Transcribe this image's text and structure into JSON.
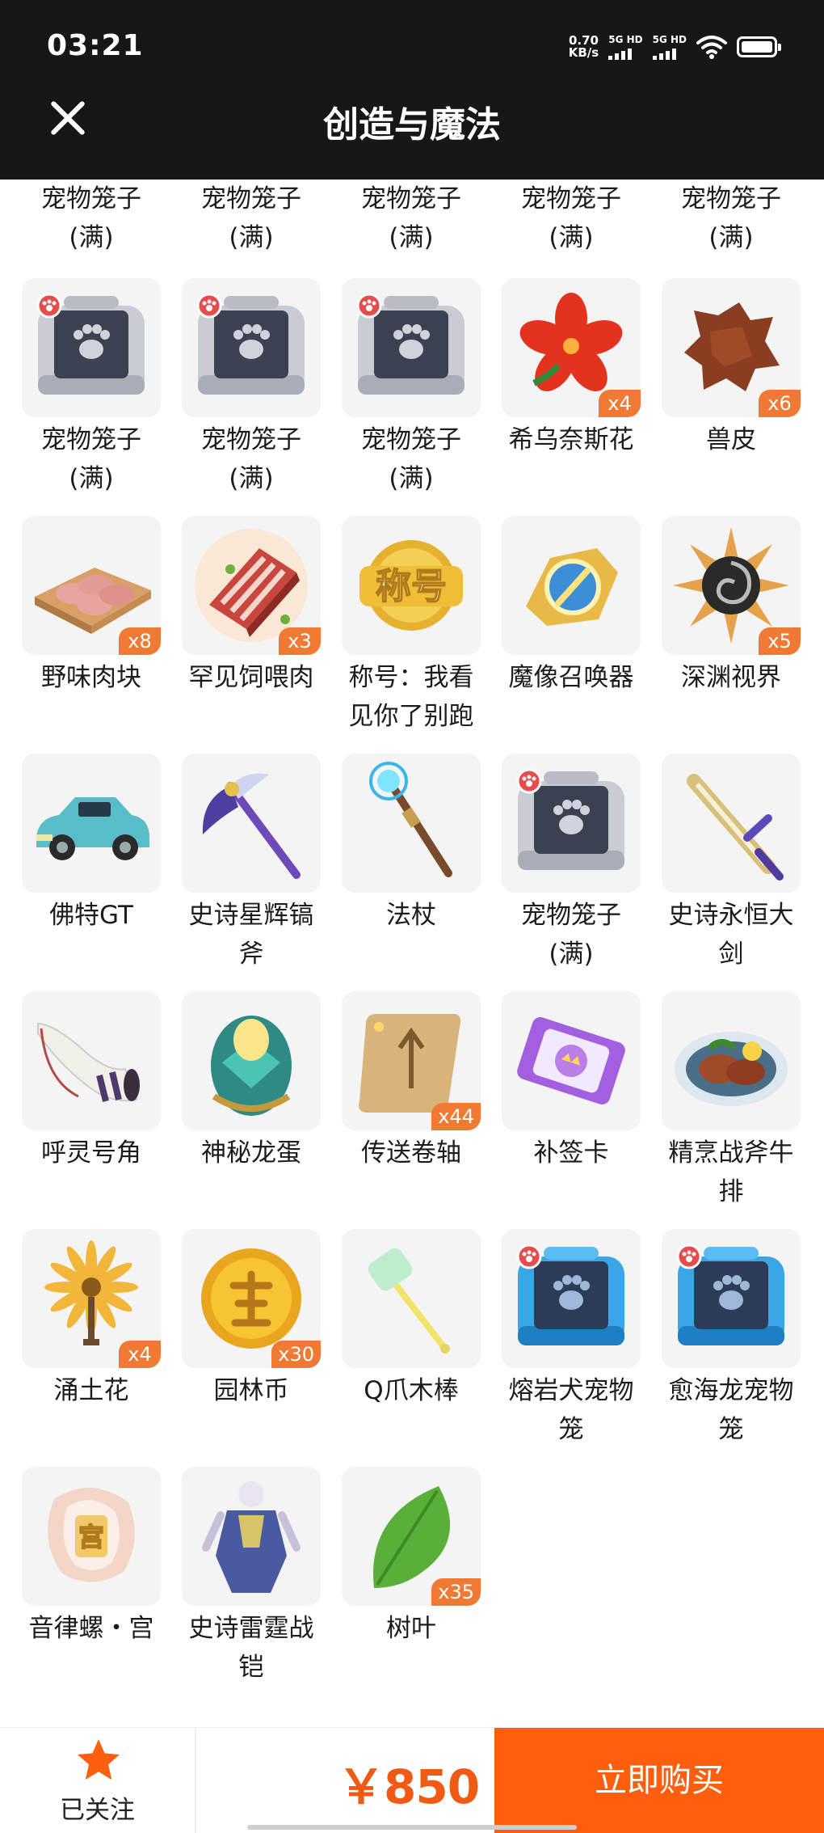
{
  "status_bar": {
    "time": "03:21",
    "speed_value": "0.70",
    "speed_unit": "KB/s",
    "sim1": "5G HD",
    "sim2": "5G HD"
  },
  "header": {
    "title": "创造与魔法"
  },
  "colors": {
    "accent": "#ff5e0e",
    "price": "#f05a14",
    "badge": "#f07a33"
  },
  "top_names": [
    "宠物笼子\n(满)",
    "宠物笼子\n(满)",
    "宠物笼子\n(满)",
    "宠物笼子\n(满)",
    "宠物笼子\n(满)"
  ],
  "items": [
    {
      "name": "宠物笼子\n(满)",
      "qty": "",
      "icon": "pet-cage-gray-icon"
    },
    {
      "name": "宠物笼子\n(满)",
      "qty": "",
      "icon": "pet-cage-gray-icon"
    },
    {
      "name": "宠物笼子\n(满)",
      "qty": "",
      "icon": "pet-cage-gray-icon"
    },
    {
      "name": "希乌奈斯花",
      "qty": "x4",
      "icon": "red-flower-icon"
    },
    {
      "name": "兽皮",
      "qty": "x6",
      "icon": "hide-icon"
    },
    {
      "name": "野味肉块",
      "qty": "x8",
      "icon": "meat-tray-icon"
    },
    {
      "name": "罕见饲喂肉",
      "qty": "x3",
      "icon": "feed-meat-icon"
    },
    {
      "name": "称号：我看\n见你了别跑",
      "qty": "",
      "icon": "title-badge-icon",
      "text": "称号"
    },
    {
      "name": "魔像召唤器",
      "qty": "",
      "icon": "golem-summoner-icon"
    },
    {
      "name": "深渊视界",
      "qty": "x5",
      "icon": "abyss-vision-icon"
    },
    {
      "name": "佛特GT",
      "qty": "",
      "icon": "car-icon"
    },
    {
      "name": "史诗星辉镐\n斧",
      "qty": "",
      "icon": "pickaxe-icon"
    },
    {
      "name": "法杖",
      "qty": "",
      "icon": "staff-icon"
    },
    {
      "name": "宠物笼子\n(满)",
      "qty": "",
      "icon": "pet-cage-gray-icon"
    },
    {
      "name": "史诗永恒大\n剑",
      "qty": "",
      "icon": "greatsword-icon"
    },
    {
      "name": "呼灵号角",
      "qty": "",
      "icon": "horn-icon"
    },
    {
      "name": "神秘龙蛋",
      "qty": "",
      "icon": "dragon-egg-icon"
    },
    {
      "name": "传送卷轴",
      "qty": "x44",
      "icon": "scroll-icon"
    },
    {
      "name": "补签卡",
      "qty": "",
      "icon": "makeup-card-icon"
    },
    {
      "name": "精烹战斧牛\n排",
      "qty": "",
      "icon": "steak-plate-icon"
    },
    {
      "name": "涌土花",
      "qty": "x4",
      "icon": "yellow-flower-icon"
    },
    {
      "name": "园林币",
      "qty": "x30",
      "icon": "coin-icon"
    },
    {
      "name": "Q爪木棒",
      "qty": "",
      "icon": "claw-stick-icon"
    },
    {
      "name": "熔岩犬宠物\n笼",
      "qty": "",
      "icon": "pet-cage-blue-icon"
    },
    {
      "name": "愈海龙宠物\n笼",
      "qty": "",
      "icon": "pet-cage-blue-icon"
    },
    {
      "name": "音律螺・宫",
      "qty": "",
      "icon": "conch-icon",
      "text": "宫"
    },
    {
      "name": "史诗雷霆战\n铠",
      "qty": "",
      "icon": "armor-icon"
    },
    {
      "name": "树叶",
      "qty": "x35",
      "icon": "leaf-icon"
    }
  ],
  "bottom_bar": {
    "follow_label": "已关注",
    "price": "￥850",
    "buy_label": "立即购买"
  }
}
